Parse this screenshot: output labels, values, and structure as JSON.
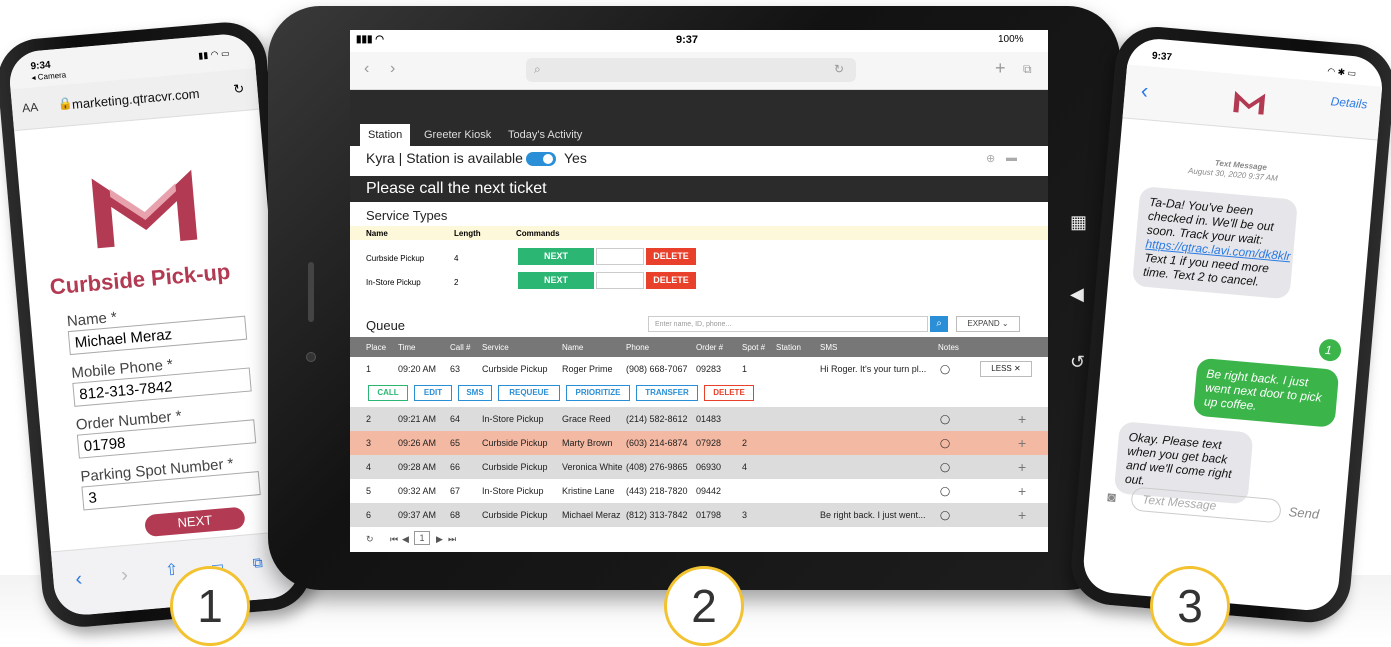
{
  "phone1": {
    "time": "9:34",
    "back_app": "◂ Camera",
    "text_size": "AA",
    "url": "marketing.qtracvr.com",
    "title": "Curbside Pick-up",
    "fields": [
      {
        "label": "Name *",
        "value": "Michael Meraz"
      },
      {
        "label": "Mobile Phone *",
        "value": "812-313-7842"
      },
      {
        "label": "Order Number *",
        "value": "01798"
      },
      {
        "label": "Parking Spot Number *",
        "value": "3"
      }
    ],
    "next_button": "NEXT",
    "brand_color": "#b23a52"
  },
  "tablet": {
    "time": "9:37",
    "battery": "100%",
    "tabs": [
      "Station",
      "Greeter Kiosk",
      "Today's Activity"
    ],
    "station_status": "Kyra | Station is available",
    "toggle_label": "Yes",
    "banner": "Please call the next ticket",
    "service_types": {
      "title": "Service Types",
      "headers": [
        "Name",
        "Length",
        "Commands"
      ],
      "rows": [
        {
          "name": "Curbside Pickup",
          "length": "4",
          "next": "NEXT",
          "delete": "DELETE"
        },
        {
          "name": "In-Store Pickup",
          "length": "2",
          "next": "NEXT",
          "delete": "DELETE"
        }
      ]
    },
    "queue": {
      "title": "Queue",
      "search_placeholder": "Enter name, ID, phone...",
      "expand_label": "EXPAND",
      "headers": [
        "Place",
        "Time",
        "Call #",
        "Service",
        "Name",
        "Phone",
        "Order #",
        "Spot #",
        "Station",
        "SMS",
        "Notes"
      ],
      "rows": [
        {
          "place": "1",
          "time": "09:20 AM",
          "call": "63",
          "service": "Curbside Pickup",
          "name": "Roger Prime",
          "phone": "(908) 668-7067",
          "order": "09283",
          "spot": "1",
          "station": "",
          "sms": "Hi Roger. It's your turn pl...",
          "toggle": "LESS ✕"
        },
        {
          "place": "2",
          "time": "09:21 AM",
          "call": "64",
          "service": "In-Store Pickup",
          "name": "Grace Reed",
          "phone": "(214) 582-8612",
          "order": "01483",
          "spot": "",
          "station": "",
          "sms": "",
          "toggle": "+"
        },
        {
          "place": "3",
          "time": "09:26 AM",
          "call": "65",
          "service": "Curbside Pickup",
          "name": "Marty Brown",
          "phone": "(603) 214-6874",
          "order": "07928",
          "spot": "2",
          "station": "",
          "sms": "",
          "toggle": "+"
        },
        {
          "place": "4",
          "time": "09:28 AM",
          "call": "66",
          "service": "Curbside Pickup",
          "name": "Veronica White",
          "phone": "(408) 276-9865",
          "order": "06930",
          "spot": "4",
          "station": "",
          "sms": "",
          "toggle": "+"
        },
        {
          "place": "5",
          "time": "09:32 AM",
          "call": "67",
          "service": "In-Store Pickup",
          "name": "Kristine Lane",
          "phone": "(443) 218-7820",
          "order": "09442",
          "spot": "",
          "station": "",
          "sms": "",
          "toggle": "+"
        },
        {
          "place": "6",
          "time": "09:37 AM",
          "call": "68",
          "service": "Curbside Pickup",
          "name": "Michael Meraz",
          "phone": "(812) 313-7842",
          "order": "01798",
          "spot": "3",
          "station": "",
          "sms": "Be right back. I just went...",
          "toggle": "+"
        }
      ],
      "actions": [
        "CALL",
        "EDIT",
        "SMS",
        "REQUEUE",
        "PRIORITIZE",
        "TRANSFER",
        "DELETE"
      ],
      "page": "1"
    },
    "colors": {
      "green": "#2bb673",
      "red": "#e8402b",
      "blue": "#2a8fd6",
      "highlight": "#f4b9a2",
      "gray_row": "#dcdcdc",
      "yellow": "#fdf8d9"
    }
  },
  "phone3": {
    "time": "9:37",
    "details": "Details",
    "meta_title": "Text Message",
    "meta_date": "August 30, 2020 9:37 AM",
    "messages": [
      {
        "dir": "in",
        "text": "Ta-Da! You've been checked in. We'll be out soon. Track your wait:",
        "link": "https://qtrac.lavi.com/dk8klr",
        "after": "Text 1 if you need more time. Text 2 to cancel."
      },
      {
        "dir": "out",
        "text": "1"
      },
      {
        "dir": "out",
        "text": "Be right back. I just went next door to pick up coffee."
      },
      {
        "dir": "in",
        "text": "Okay. Please text when you get back and we'll come right out."
      }
    ],
    "input_placeholder": "Text Message",
    "send": "Send"
  },
  "steps": [
    "1",
    "2",
    "3"
  ]
}
